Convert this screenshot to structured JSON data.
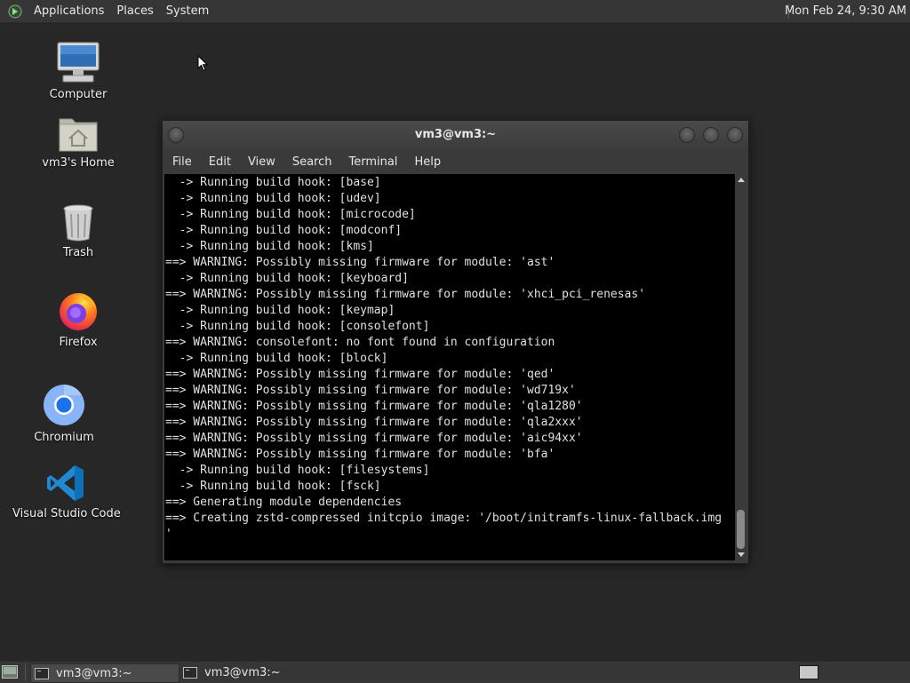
{
  "top_panel": {
    "menus": [
      "Applications",
      "Places",
      "System"
    ],
    "clock": "Mon Feb 24,  9:30 AM"
  },
  "desktop_icons": {
    "computer": "Computer",
    "home": "vm3's Home",
    "trash": "Trash",
    "firefox": "Firefox",
    "chromium": "Chromium",
    "vscode": "Visual Studio Code"
  },
  "terminal": {
    "title": "vm3@vm3:~",
    "menu": [
      "File",
      "Edit",
      "View",
      "Search",
      "Terminal",
      "Help"
    ],
    "lines": [
      "  -> Running build hook: [base]",
      "  -> Running build hook: [udev]",
      "  -> Running build hook: [microcode]",
      "  -> Running build hook: [modconf]",
      "  -> Running build hook: [kms]",
      "==> WARNING: Possibly missing firmware for module: 'ast'",
      "  -> Running build hook: [keyboard]",
      "==> WARNING: Possibly missing firmware for module: 'xhci_pci_renesas'",
      "  -> Running build hook: [keymap]",
      "  -> Running build hook: [consolefont]",
      "==> WARNING: consolefont: no font found in configuration",
      "  -> Running build hook: [block]",
      "==> WARNING: Possibly missing firmware for module: 'qed'",
      "==> WARNING: Possibly missing firmware for module: 'wd719x'",
      "==> WARNING: Possibly missing firmware for module: 'qla1280'",
      "==> WARNING: Possibly missing firmware for module: 'qla2xxx'",
      "==> WARNING: Possibly missing firmware for module: 'aic94xx'",
      "==> WARNING: Possibly missing firmware for module: 'bfa'",
      "  -> Running build hook: [filesystems]",
      "  -> Running build hook: [fsck]",
      "==> Generating module dependencies",
      "==> Creating zstd-compressed initcpio image: '/boot/initramfs-linux-fallback.img",
      "'"
    ]
  },
  "taskbar": {
    "tasks": [
      "vm3@vm3:~",
      "vm3@vm3:~"
    ]
  },
  "colors": {
    "desktop_bg": "#272727",
    "panel_bg": "#363636",
    "terminal_bg": "#000000",
    "terminal_fg": "#e0e0e0"
  }
}
